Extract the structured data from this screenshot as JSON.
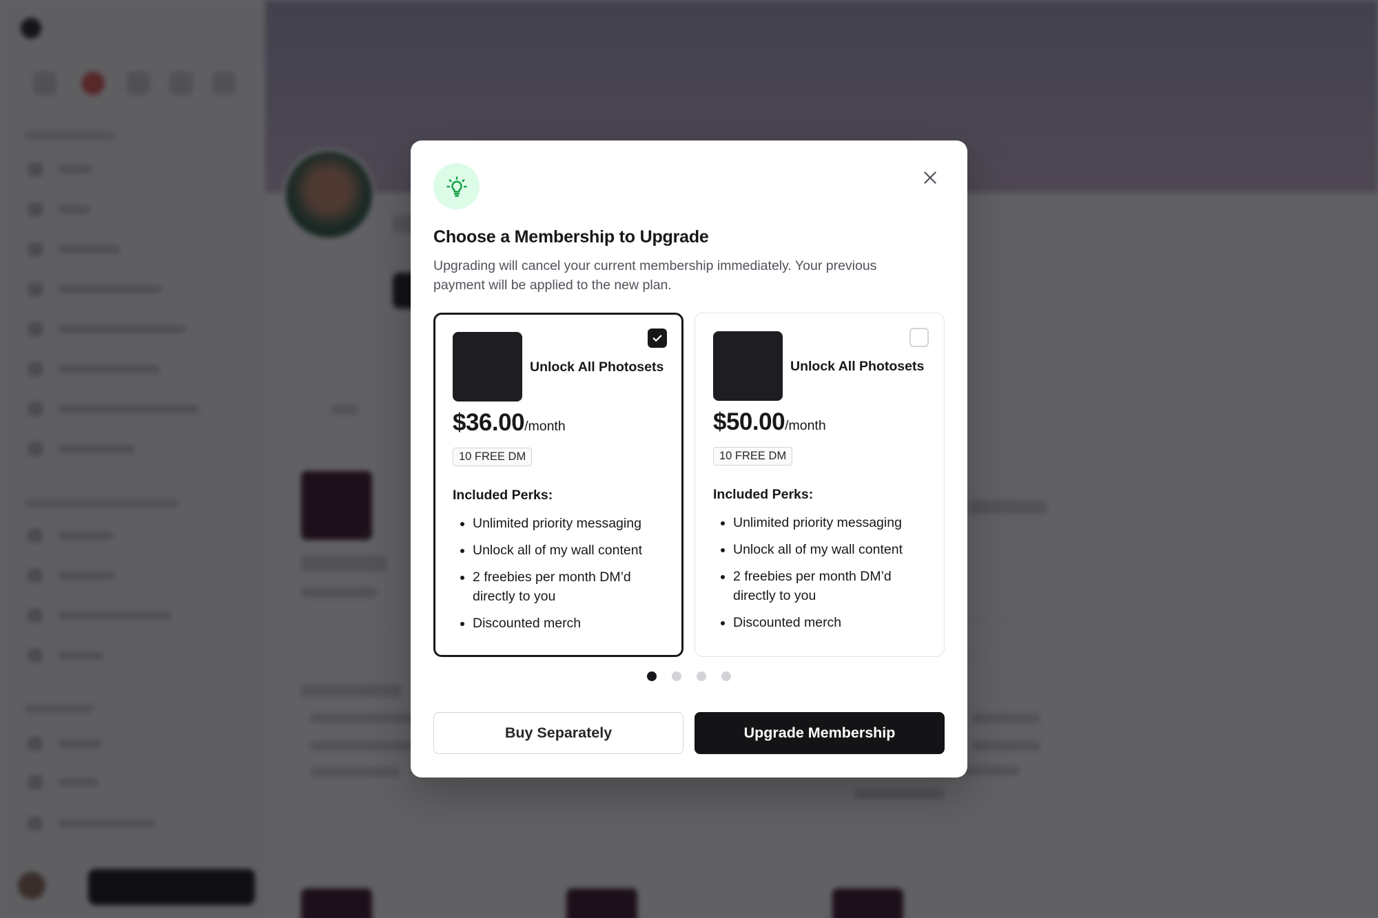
{
  "modal": {
    "title": "Choose a Membership to Upgrade",
    "subtitle": "Upgrading will cancel your current membership immediately. Your previous payment will be applied to the new plan.",
    "icon": "lightbulb-icon",
    "icon_color": "#16a34a",
    "icon_bg": "#dcfce7",
    "close_icon": "close-icon"
  },
  "plans": [
    {
      "name": "Unlock All Photosets",
      "price": "$36.00",
      "period": "/month",
      "badge": "10 FREE DM",
      "perks_heading": "Included Perks:",
      "perks": [
        "Unlimited priority messaging",
        "Unlock all of my wall content",
        "2 freebies per month DM’d directly to you",
        "Discounted merch"
      ],
      "selected": true
    },
    {
      "name": "Unlock All Photosets",
      "price": "$50.00",
      "period": "/month",
      "badge": "10 FREE DM",
      "perks_heading": "Included Perks:",
      "perks": [
        "Unlimited priority messaging",
        "Unlock all of my wall content",
        "2 freebies per month DM’d directly to you",
        "Discounted merch"
      ],
      "selected": false
    }
  ],
  "pagination": {
    "total": 4,
    "active": 1
  },
  "actions": {
    "secondary_label": "Buy Separately",
    "primary_label": "Upgrade Membership"
  },
  "colors": {
    "primary": "#141416",
    "overlay": "rgba(15,15,20,0.66)",
    "accent_green": "#16a34a"
  }
}
